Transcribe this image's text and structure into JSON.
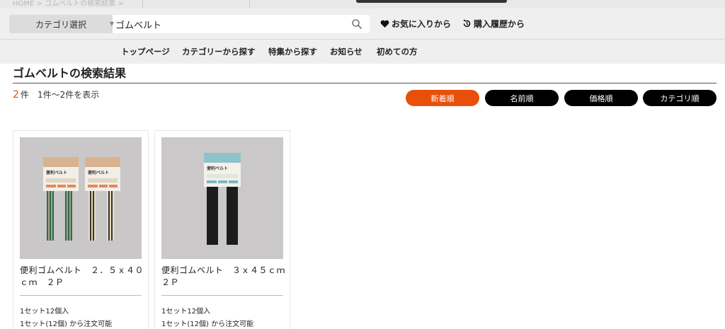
{
  "breadcrumb": "HOME > ゴムベルトの検索結果 >",
  "search": {
    "category_label": "カテゴリ選択",
    "query": "ゴムベルト"
  },
  "header_links": {
    "favorites": "お気に入りから",
    "history": "購入履歴から"
  },
  "nav": [
    "トップページ",
    "カテゴリーから探す",
    "特集から探す",
    "お知らせ",
    "初めての方"
  ],
  "results": {
    "title": "ゴムベルトの検索結果",
    "count": "2",
    "count_unit": "件",
    "range": "1件～2件を表示"
  },
  "sort": {
    "buttons": [
      "新着順",
      "名前順",
      "価格順",
      "カテゴリ順"
    ],
    "active": "新着順"
  },
  "products": [
    {
      "name": "便利ゴムベルト　２．５ｘ４０ｃｍ　２Ｐ",
      "set": "1セット12個入",
      "order": "1セット(12個) から注文可能",
      "package_label": "便利ベルト"
    },
    {
      "name": "便利ゴムベルト　３ｘ４５ｃｍ　２Ｐ",
      "set": "1セット12個入",
      "order": "1セット(12個) から注文可能",
      "package_label": "便利ベルト"
    }
  ],
  "colors": {
    "accent": "#e8500a",
    "button_dark": "#000000",
    "header_bg": "#efefef"
  }
}
